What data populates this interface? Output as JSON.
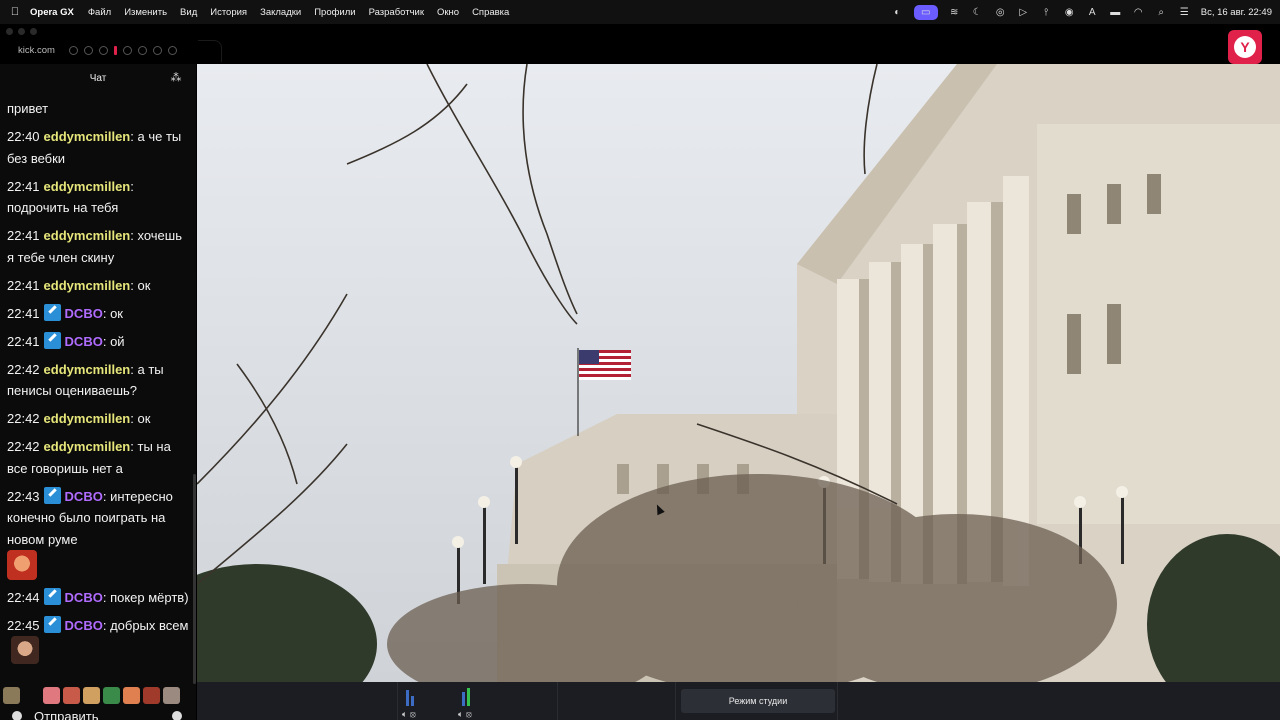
{
  "menubar": {
    "app": "Opera GX",
    "items": [
      "Файл",
      "Изменить",
      "Вид",
      "История",
      "Закладки",
      "Профили",
      "Разработчик",
      "Окно",
      "Справка"
    ],
    "clock": "Вс, 16 авг.  22:49"
  },
  "browser": {
    "url": "kick.com"
  },
  "chat": {
    "header": "Чат",
    "messages": [
      {
        "time": "",
        "user": "",
        "text": "привет",
        "kind": "plain"
      },
      {
        "time": "22:40",
        "user": "eddymcmillen",
        "text": "а че ты без вебки",
        "kind": "u1"
      },
      {
        "time": "22:41",
        "user": "eddymcmillen",
        "text": "подрочить на тебя",
        "kind": "u1"
      },
      {
        "time": "22:41",
        "user": "eddymcmillen",
        "text": "хочешь я тебе член скину",
        "kind": "u1"
      },
      {
        "time": "22:41",
        "user": "eddymcmillen",
        "text": "ок",
        "kind": "u1"
      },
      {
        "time": "22:41",
        "user": "DCBO",
        "text": "ок",
        "kind": "u2"
      },
      {
        "time": "22:41",
        "user": "DCBO",
        "text": "ой",
        "kind": "u2"
      },
      {
        "time": "22:42",
        "user": "eddymcmillen",
        "text": "а ты пенисы оцениваешь?",
        "kind": "u1"
      },
      {
        "time": "22:42",
        "user": "eddymcmillen",
        "text": "ок",
        "kind": "u1"
      },
      {
        "time": "22:42",
        "user": "eddymcmillen",
        "text": "ты на все говоришь нет а",
        "kind": "u1"
      },
      {
        "time": "22:43",
        "user": "DCBO",
        "text": "интересно конечно было поиграть на новом руме",
        "kind": "u2",
        "emote": "face1"
      },
      {
        "time": "22:44",
        "user": "DCBO",
        "text": "покер мёртв)",
        "kind": "u2"
      },
      {
        "time": "22:45",
        "user": "DCBO",
        "text": "добрых всем",
        "kind": "u2",
        "emote": "face2"
      }
    ],
    "send_label": "Отправить"
  },
  "controls": {
    "studio_mode": "Режим студии"
  },
  "colors": {
    "user_yellow": "#e6e67a",
    "user_purple": "#b06cff",
    "accent": "#e0224a"
  }
}
